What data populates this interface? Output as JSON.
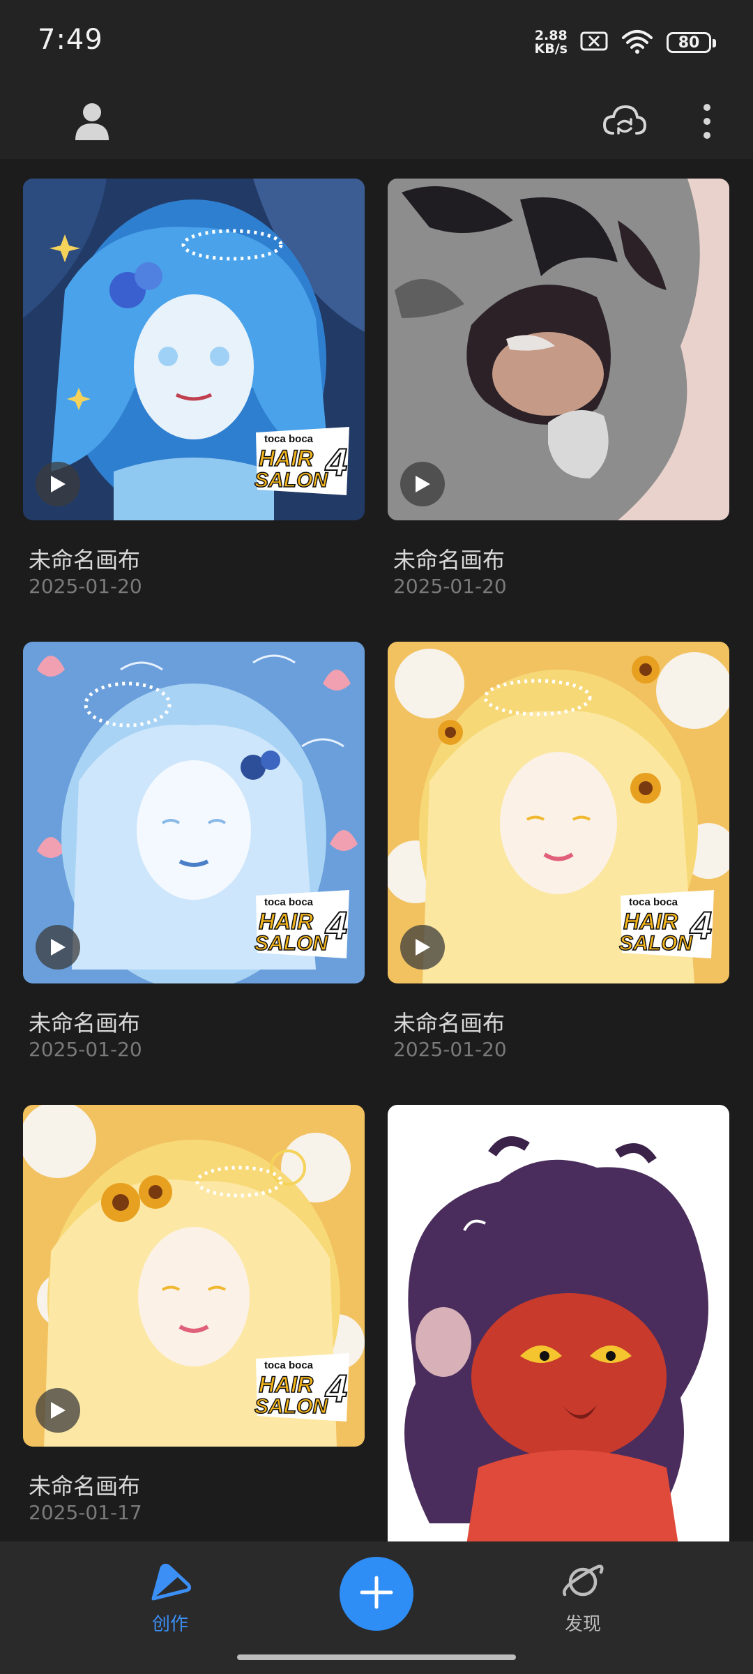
{
  "status_bar": {
    "time": "7:49",
    "net_speed_value": "2.88",
    "net_speed_unit": "KB/s",
    "battery": "80"
  },
  "app_bar": {
    "icons": [
      "profile-icon",
      "cloud-sync-icon",
      "more-vert-icon"
    ]
  },
  "canvases": [
    {
      "title": "未命名画布",
      "date": "2025-01-20",
      "has_play": true,
      "has_logo": true
    },
    {
      "title": "未命名画布",
      "date": "2025-01-20",
      "has_play": true,
      "has_logo": false
    },
    {
      "title": "未命名画布",
      "date": "2025-01-20",
      "has_play": true,
      "has_logo": true
    },
    {
      "title": "未命名画布",
      "date": "2025-01-20",
      "has_play": true,
      "has_logo": true
    },
    {
      "title": "未命名画布",
      "date": "2025-01-17",
      "has_play": true,
      "has_logo": true
    },
    {
      "title": "",
      "date": "",
      "has_play": false,
      "has_logo": false
    }
  ],
  "logo_text": {
    "brand": "toca boca",
    "line1": "HAIR",
    "line2": "SALON",
    "number": "4"
  },
  "bottom_nav": {
    "create_label": "创作",
    "discover_label": "发现"
  },
  "colors": {
    "accent": "#2f8ef5",
    "background": "#232323"
  }
}
